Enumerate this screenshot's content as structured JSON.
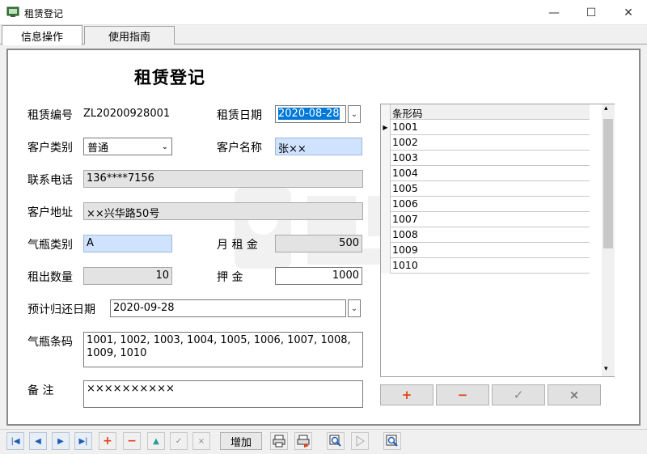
{
  "window": {
    "title": "租赁登记",
    "minimize": "—",
    "maximize": "☐",
    "close": "✕"
  },
  "tabs": [
    {
      "label": "信息操作"
    },
    {
      "label": "使用指南"
    }
  ],
  "form": {
    "title": "租赁登记",
    "rental_no_label": "租赁编号",
    "rental_no_value": "ZL20200928001",
    "rental_date_label": "租赁日期",
    "rental_date_value": "2020-08-28",
    "customer_type_label": "客户类别",
    "customer_type_value": "普通",
    "customer_name_label": "客户名称",
    "customer_name_value": "张××",
    "phone_label": "联系电话",
    "phone_value": "136****7156",
    "address_label": "客户地址",
    "address_value": "××兴华路50号",
    "cylinder_type_label": "气瓶类别",
    "cylinder_type_value": "A",
    "monthly_rent_label": "月 租 金",
    "monthly_rent_value": "500",
    "quantity_label": "租出数量",
    "quantity_value": "10",
    "deposit_label": "押    金",
    "deposit_value": "1000",
    "return_date_label": "预计归还日期",
    "return_date_value": "2020-09-28",
    "barcodes_label": "气瓶条码",
    "barcodes_value": "1001, 1002, 1003, 1004, 1005, 1006, 1007, 1008, 1009, 1010",
    "notes_label": "备    注",
    "notes_value": "××××××××××"
  },
  "grid": {
    "header": "条形码",
    "rows": [
      "1001",
      "1002",
      "1003",
      "1004",
      "1005",
      "1006",
      "1007",
      "1008",
      "1009",
      "1010"
    ],
    "current_row_marker": "▶"
  },
  "grid_buttons": {
    "add": "+",
    "remove": "−",
    "confirm": "✓",
    "cancel": "×"
  },
  "toolbar": {
    "first": "|◀",
    "prev": "◀",
    "next": "▶",
    "last": "▶|",
    "add": "+",
    "remove": "−",
    "up": "▲",
    "confirm": "✓",
    "cancel": "×",
    "add_label": "增加"
  },
  "colors": {
    "selected_date_bg": "#0078d7",
    "highlight_field": "#cfe3ff",
    "readonly_field": "#e3e3e3",
    "accent_red": "#e0401a"
  }
}
